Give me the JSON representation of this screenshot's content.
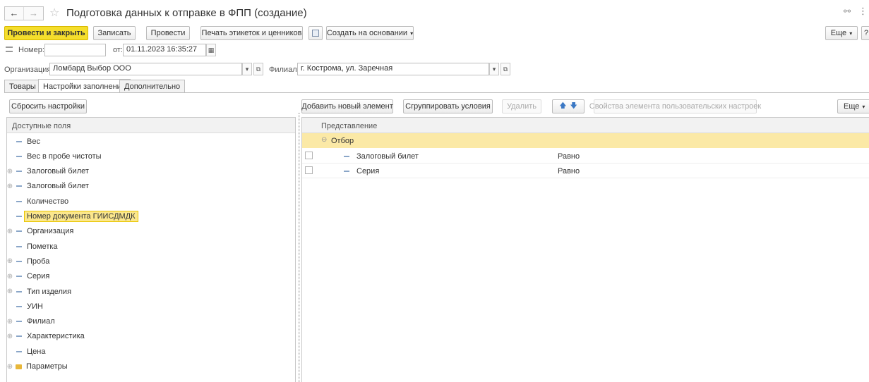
{
  "window": {
    "title": "Подготовка данных к отправке в ФПП (создание)",
    "back_icon": "←",
    "forward_icon": "→",
    "star_icon": "☆",
    "link_icon": "🔗",
    "more_icon": "⋮"
  },
  "toolbar": {
    "post_close": "Провести и закрыть",
    "save": "Записать",
    "post": "Провести",
    "print_labels": "Печать этикеток и ценников",
    "create_based": "Создать на основании",
    "more": "Еще"
  },
  "header": {
    "number_label": "Номер:",
    "number_value": "",
    "date_label": "от:",
    "date_value": "01.11.2023 16:35:27",
    "org_label": "Организация:",
    "org_value": "Ломбард Выбор ООО",
    "branch_label": "Филиал:",
    "branch_value": "г. Кострома, ул. Заречная"
  },
  "tabs": [
    "Товары",
    "Настройки заполнения",
    "Дополнительно"
  ],
  "left_panel": {
    "reset_button": "Сбросить настройки",
    "header": "Доступные поля",
    "items": [
      {
        "label": "Вес",
        "expandable": false,
        "type": "field"
      },
      {
        "label": "Вес в пробе чистоты",
        "expandable": false,
        "type": "field"
      },
      {
        "label": "Залоговый билет",
        "expandable": true,
        "type": "field"
      },
      {
        "label": "Залоговый билет",
        "expandable": true,
        "type": "field"
      },
      {
        "label": "Количество",
        "expandable": false,
        "type": "field"
      },
      {
        "label": "Номер документа ГИИСДМДК",
        "expandable": false,
        "type": "field",
        "selected": true
      },
      {
        "label": "Организация",
        "expandable": true,
        "type": "field"
      },
      {
        "label": "Пометка",
        "expandable": false,
        "type": "field"
      },
      {
        "label": "Проба",
        "expandable": true,
        "type": "field"
      },
      {
        "label": "Серия",
        "expandable": true,
        "type": "field"
      },
      {
        "label": "Тип изделия",
        "expandable": true,
        "type": "field"
      },
      {
        "label": "УИН",
        "expandable": false,
        "type": "field"
      },
      {
        "label": "Филиал",
        "expandable": true,
        "type": "field"
      },
      {
        "label": "Характеристика",
        "expandable": true,
        "type": "field"
      },
      {
        "label": "Цена",
        "expandable": false,
        "type": "field"
      },
      {
        "label": "Параметры",
        "expandable": true,
        "type": "folder"
      }
    ]
  },
  "right_panel": {
    "add_button": "Добавить новый элемент",
    "group_button": "Сгруппировать условия",
    "delete_button": "Удалить",
    "props_button": "Свойства элемента пользовательских настроек",
    "more": "Еще",
    "header": "Представление",
    "group_label": "Отбор",
    "rows": [
      {
        "field": "Залоговый билет",
        "condition": "Равно"
      },
      {
        "field": "Серия",
        "condition": "Равно"
      }
    ]
  },
  "colors": {
    "accent_yellow": "#f5de2c",
    "highlight_row": "#fbe9a6"
  }
}
